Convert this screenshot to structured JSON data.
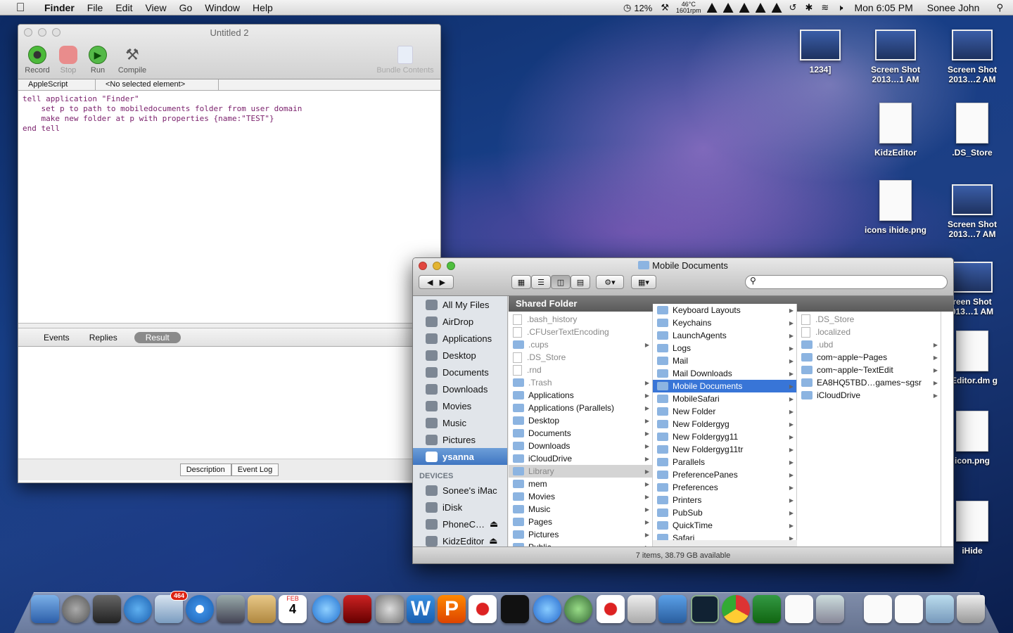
{
  "menubar": {
    "app": "Finder",
    "menus": [
      "File",
      "Edit",
      "View",
      "Go",
      "Window",
      "Help"
    ],
    "battery": "12%",
    "temp": "46°C",
    "rpm": "1601rpm",
    "clock": "Mon 6:05 PM",
    "user": "Sonee John"
  },
  "script_editor": {
    "title": "Untitled 2",
    "tools": [
      "Record",
      "Stop",
      "Run",
      "Compile"
    ],
    "bundle": "Bundle Contents",
    "language": "AppleScript",
    "element": "<No selected element>",
    "code": [
      "tell application \"Finder\"",
      "    set p to path to mobiledocuments folder from user domain",
      "    make new folder at p with properties {name:\"TEST\"}",
      "end tell"
    ],
    "tabs": [
      "Events",
      "Replies",
      "Result"
    ],
    "bottom_tabs": [
      "Description",
      "Event Log"
    ]
  },
  "desktop": [
    {
      "label": "1234]",
      "kind": "shot"
    },
    {
      "label": "Screen Shot 2013…1 AM",
      "kind": "shot"
    },
    {
      "label": "Screen Shot 2013…2 AM",
      "kind": "shot"
    },
    {
      "label": "KidzEditor",
      "kind": "doc"
    },
    {
      "label": ".DS_Store",
      "kind": "doc"
    },
    {
      "label": "icons ihide.png",
      "kind": "doc"
    },
    {
      "label": "Screen Shot 2013…7 AM",
      "kind": "shot"
    },
    {
      "label": "reen Shot 013…1 AM",
      "kind": "shot"
    },
    {
      "label": "zEditor.dm g",
      "kind": "doc"
    },
    {
      "label": "icon.png",
      "kind": "doc"
    },
    {
      "label": "iHide",
      "kind": "doc"
    }
  ],
  "finder": {
    "title": "Mobile Documents",
    "path_header": "Shared Folder",
    "status": "7 items, 38.79 GB available",
    "favorites": [
      "All My Files",
      "AirDrop",
      "Applications",
      "Desktop",
      "Documents",
      "Downloads",
      "Movies",
      "Music",
      "Pictures",
      "ysanna"
    ],
    "devices_header": "DEVICES",
    "devices": [
      "Sonee's iMac",
      "iDisk",
      "PhoneC…",
      "KidzEditor"
    ],
    "col1": [
      ".bash_history",
      ".CFUserTextEncoding",
      ".cups",
      ".DS_Store",
      ".rnd",
      ".Trash",
      "Applications",
      "Applications (Parallels)",
      "Desktop",
      "Documents",
      "Downloads",
      "iCloudDrive",
      "Library",
      "mem",
      "Movies",
      "Music",
      "Pages",
      "Pictures",
      "Public"
    ],
    "col2": [
      "Keyboard Layouts",
      "Keychains",
      "LaunchAgents",
      "Logs",
      "Mail",
      "Mail Downloads",
      "Mobile Documents",
      "MobileSafari",
      "New Folder",
      "New Foldergyg",
      "New Foldergyg11",
      "New Foldergyg11tr",
      "Parallels",
      "PreferencePanes",
      "Preferences",
      "Printers",
      "PubSub",
      "QuickTime",
      "Safari"
    ],
    "col3": [
      ".DS_Store",
      ".localized",
      ".ubd",
      "com~apple~Pages",
      "com~apple~TextEdit",
      "EA8HQ5TBD…games~sgsr",
      "iCloudDrive"
    ]
  },
  "dock": {
    "mail_badge": "464",
    "calendar_day": "4",
    "calendar_month": "FEB"
  }
}
